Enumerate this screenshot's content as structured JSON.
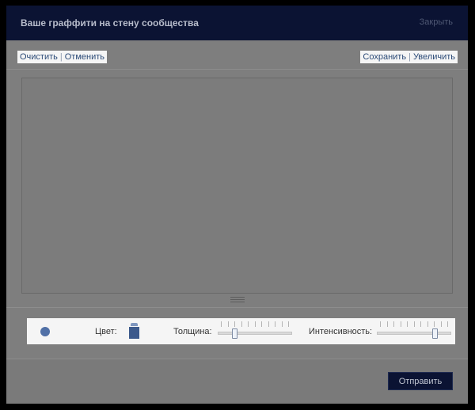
{
  "dialog": {
    "title": "Ваше граффити на стену сообщества",
    "close_label": "Закрыть"
  },
  "toolbar": {
    "clear_label": "Очистить",
    "undo_label": "Отменить",
    "save_label": "Сохранить",
    "zoom_label": "Увеличить"
  },
  "controls": {
    "color_label": "Цвет:",
    "thickness_label": "Толщина:",
    "intensity_label": "Интенсивность:",
    "thickness_value_percent": 20,
    "intensity_value_percent": 80,
    "brush_color": "#5170a6",
    "selected_color": "#3c5a8c"
  },
  "footer": {
    "send_label": "Отправить"
  },
  "icons": {
    "brush_preview": "circle",
    "color_picker": "paint-can-icon",
    "resize_handle": "horizontal-grip"
  }
}
